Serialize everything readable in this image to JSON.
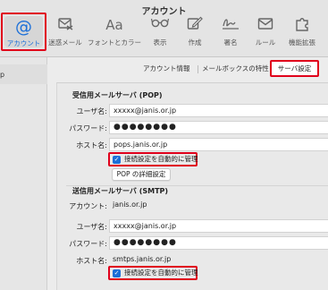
{
  "window": {
    "title": "アカウント"
  },
  "toolbar": {
    "items": [
      {
        "label": "アカウント",
        "icon": "at-icon"
      },
      {
        "label": "迷惑メール",
        "icon": "junk-mail-icon"
      },
      {
        "label": "フォントとカラー",
        "icon": "fonts-colors-icon"
      },
      {
        "label": "表示",
        "icon": "glasses-icon"
      },
      {
        "label": "作成",
        "icon": "compose-icon"
      },
      {
        "label": "署名",
        "icon": "signature-icon"
      },
      {
        "label": "ルール",
        "icon": "rules-icon"
      },
      {
        "label": "機能拡張",
        "icon": "puzzle-icon"
      }
    ],
    "account_glyph": "@",
    "fonts_glyph": "Aa"
  },
  "sidebar": {
    "selected_fragment": "p"
  },
  "tabs": [
    {
      "label": "アカウント情報"
    },
    {
      "label": "メールボックスの特性"
    },
    {
      "label": "サーバ設定",
      "active": true
    }
  ],
  "incoming": {
    "heading": "受信用メールサーバ (POP)",
    "username_label": "ユーザ名:",
    "username_value": "xxxxx@janis.or.jp",
    "password_label": "パスワード:",
    "password_value": "●●●●●●●●",
    "host_label": "ホスト名:",
    "host_value": "pops.janis.or.jp",
    "auto_manage_label": "接続設定を自動的に管理",
    "details_button": "POP の詳細設定"
  },
  "outgoing": {
    "heading": "送信用メールサーバ (SMTP)",
    "account_label": "アカウント:",
    "account_value": "janis.or.jp",
    "username_label": "ユーザ名:",
    "username_value": "xxxxx@janis.or.jp",
    "password_label": "パスワード:",
    "password_value": "●●●●●●●●",
    "host_label": "ホスト名:",
    "host_value": "smtps.janis.or.jp",
    "auto_manage_label": "接続設定を自動的に管理"
  },
  "colors": {
    "highlight": "#e0001b",
    "accent": "#1b6fd8"
  }
}
